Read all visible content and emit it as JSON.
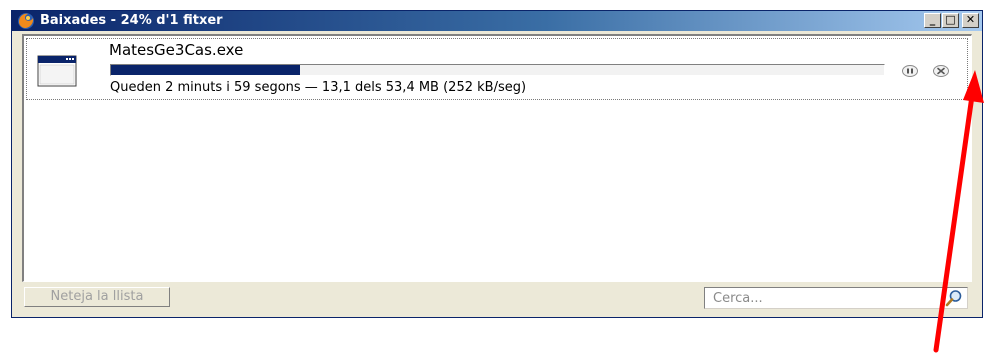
{
  "window": {
    "title": "Baixades - 24% d'1 fitxer",
    "controls": {
      "minimize": "_",
      "maximize": "□",
      "close": "✕"
    }
  },
  "download": {
    "file_name": "MatesGe3Cas.exe",
    "progress_fraction": 0.245,
    "status": "Queden 2 minuts i 59 segons — 13,1 dels 53,4 MB (252 kB/seg)"
  },
  "footer": {
    "clear_list_label": "Neteja la llista",
    "search_placeholder": "Cerca..."
  },
  "icons": {
    "app": "firefox-icon",
    "file": "executable-window-icon",
    "pause": "pause-icon",
    "cancel": "cancel-icon",
    "search": "search-icon"
  },
  "colors": {
    "titlebar_start": "#0a246a",
    "titlebar_end": "#a6caf0",
    "progress_fill": "#0a246a",
    "annotation_arrow": "#ff0000"
  }
}
